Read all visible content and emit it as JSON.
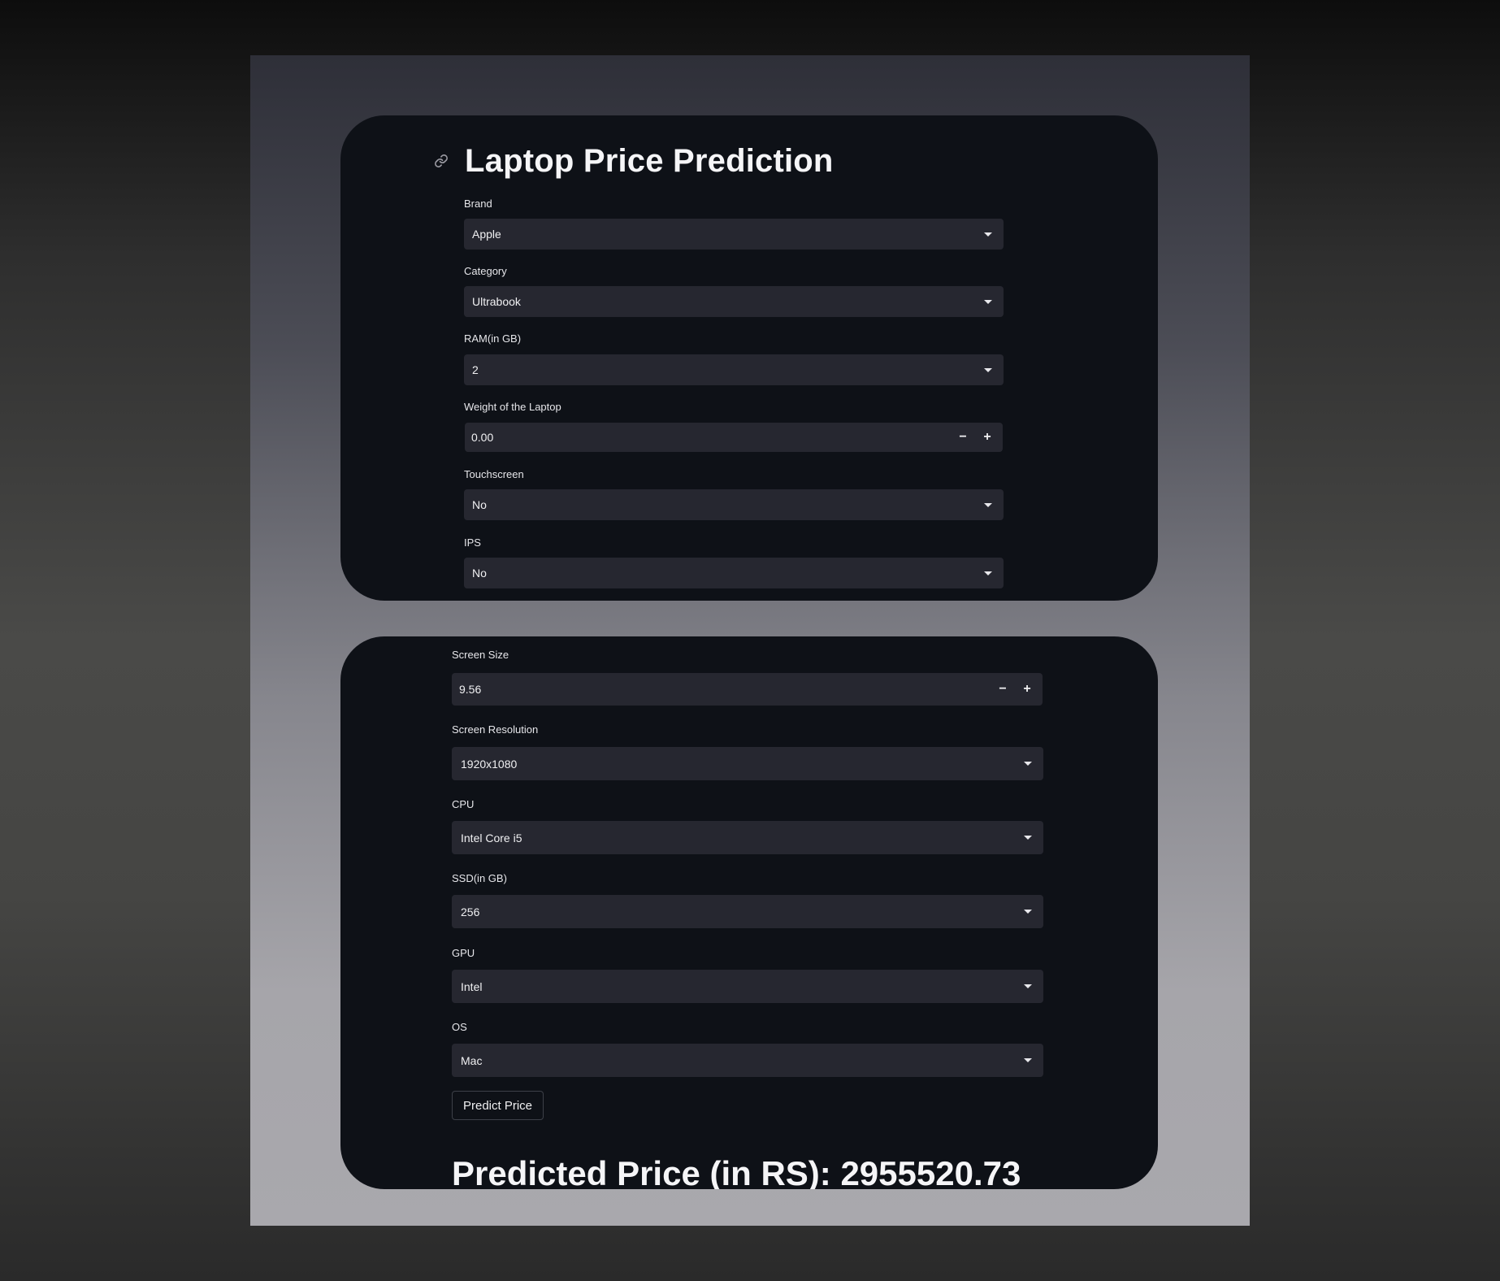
{
  "app": {
    "title": "Laptop Price Prediction"
  },
  "form1": {
    "brand": {
      "label": "Brand",
      "value": "Apple"
    },
    "category": {
      "label": "Category",
      "value": "Ultrabook"
    },
    "ram": {
      "label": "RAM(in GB)",
      "value": "2"
    },
    "weight": {
      "label": "Weight of the Laptop",
      "value": "0.00",
      "minus": "−",
      "plus": "+"
    },
    "touchscreen": {
      "label": "Touchscreen",
      "value": "No"
    },
    "ips": {
      "label": "IPS",
      "value": "No"
    }
  },
  "form2": {
    "screen_size": {
      "label": "Screen Size",
      "value": "9.56",
      "minus": "−",
      "plus": "+"
    },
    "resolution": {
      "label": "Screen Resolution",
      "value": "1920x1080"
    },
    "cpu": {
      "label": "CPU",
      "value": "Intel Core i5"
    },
    "ssd": {
      "label": "SSD(in GB)",
      "value": "256"
    },
    "gpu": {
      "label": "GPU",
      "value": "Intel"
    },
    "os": {
      "label": "OS",
      "value": "Mac"
    },
    "predict_label": "Predict Price",
    "result_text": "Predicted Price (in RS): 2955520.73"
  },
  "icons": {
    "anchor": "link-icon",
    "dropdown": "chevron-down-icon"
  },
  "colors": {
    "card_bg": "#0e1117",
    "field_bg": "#262730",
    "text": "#f0f0f2"
  }
}
